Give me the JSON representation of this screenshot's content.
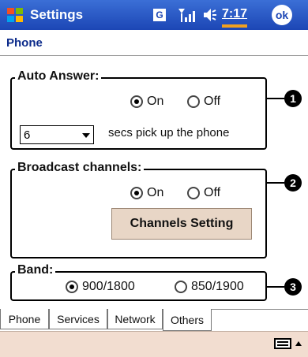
{
  "titlebar": {
    "title": "Settings",
    "tray_g": "G",
    "clock": "7:17",
    "ok_label": "ok"
  },
  "page_title": "Phone",
  "auto_answer": {
    "legend": "Auto Answer:",
    "on_label": "On",
    "off_label": "Off",
    "selected": "On",
    "select_value": "6",
    "pick_text": "secs pick up the phone",
    "callout": "1"
  },
  "broadcast": {
    "legend": "Broadcast channels:",
    "on_label": "On",
    "off_label": "Off",
    "selected": "On",
    "button_label": "Channels Setting",
    "callout": "2"
  },
  "band": {
    "legend": "Band:",
    "opt1": "900/1800",
    "opt2": "850/1900",
    "selected": "900/1800",
    "callout": "3"
  },
  "tabs": [
    "Phone",
    "Services",
    "Network",
    "Others"
  ],
  "active_tab": "Others",
  "colors": {
    "titlebar": "#1c46b5",
    "button_bg": "#e8d6c6",
    "bottombar": "#f2ddd0"
  }
}
